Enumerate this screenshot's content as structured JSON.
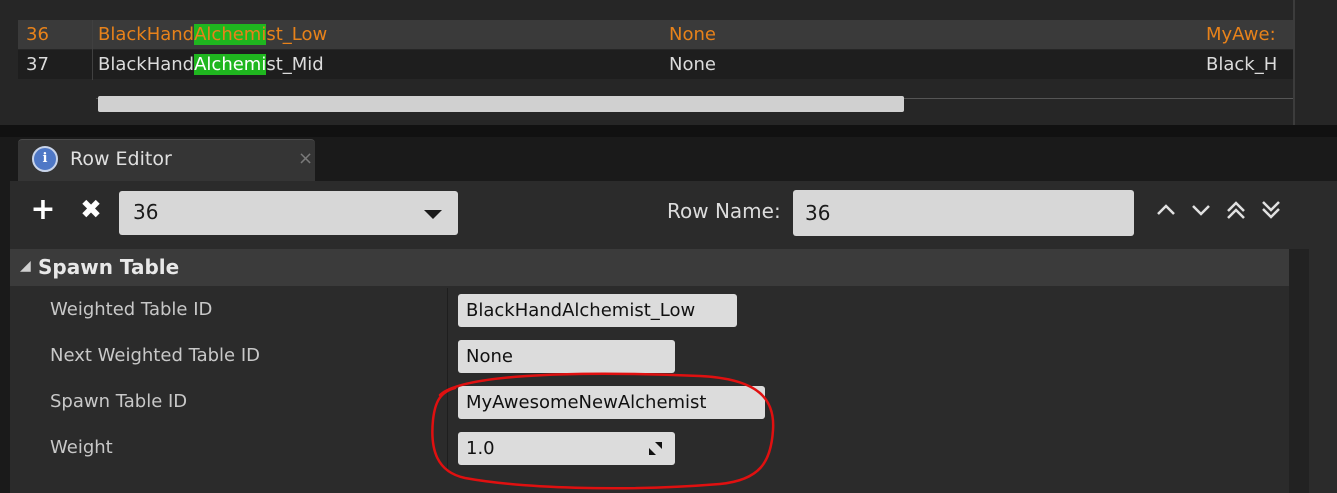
{
  "table": {
    "rows": [
      {
        "num": "36",
        "name_pre": "BlackHand",
        "name_hl": "Alchemi",
        "name_post": "st_Low",
        "next": "None",
        "spawn": "MyAwe:"
      },
      {
        "num": "37",
        "name_pre": "BlackHand",
        "name_hl": "Alchemi",
        "name_post": "st_Mid",
        "next": "None",
        "spawn": "Black_H"
      }
    ]
  },
  "tab": {
    "title": "Row Editor",
    "close": "×",
    "icon_glyph": "i"
  },
  "toolbar": {
    "add_label": "+",
    "remove_label": "✖",
    "row_select_value": "36",
    "row_name_label": "Row Name:",
    "row_name_value": "36"
  },
  "section": {
    "caret": "◢",
    "title": "Spawn Table"
  },
  "properties": [
    {
      "label": "Weighted Table ID",
      "value": "BlackHandAlchemist_Low"
    },
    {
      "label": "Next Weighted Table ID",
      "value": "None"
    },
    {
      "label": "Spawn Table ID",
      "value": "MyAwesomeNewAlchemist"
    },
    {
      "label": "Weight",
      "value": "1.0"
    }
  ],
  "colors": {
    "selected_row_text": "#e8821a",
    "highlight": "#1fb61f",
    "annotation": "#e01010"
  }
}
